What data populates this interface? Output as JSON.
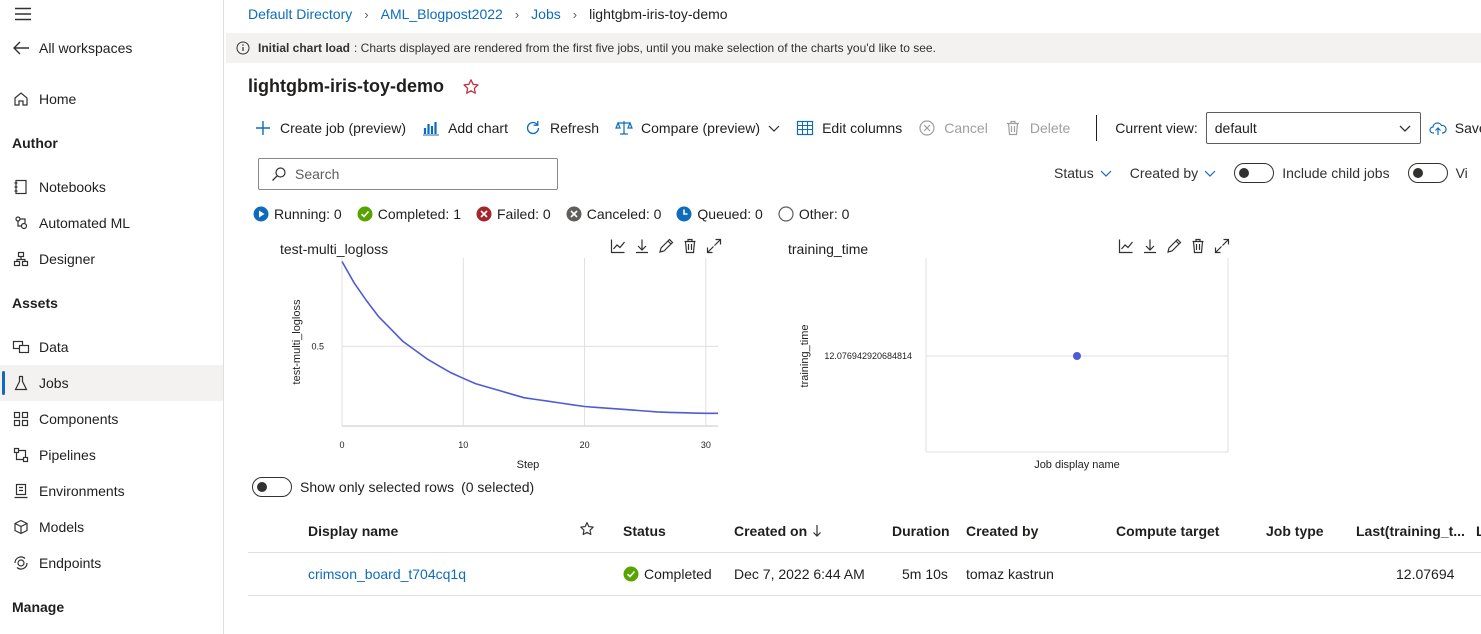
{
  "sidebar": {
    "back_label": "All workspaces",
    "home_label": "Home",
    "author_heading": "Author",
    "author_items": [
      {
        "label": "Notebooks",
        "icon": "notebook-icon"
      },
      {
        "label": "Automated ML",
        "icon": "automl-icon"
      },
      {
        "label": "Designer",
        "icon": "designer-icon"
      }
    ],
    "assets_heading": "Assets",
    "assets_items": [
      {
        "label": "Data",
        "icon": "data-icon"
      },
      {
        "label": "Jobs",
        "icon": "flask-icon",
        "active": true
      },
      {
        "label": "Components",
        "icon": "components-icon"
      },
      {
        "label": "Pipelines",
        "icon": "pipelines-icon"
      },
      {
        "label": "Environments",
        "icon": "environments-icon"
      },
      {
        "label": "Models",
        "icon": "cube-icon"
      },
      {
        "label": "Endpoints",
        "icon": "endpoints-icon"
      }
    ],
    "manage_heading": "Manage"
  },
  "breadcrumb": [
    "Default Directory",
    "AML_Blogpost2022",
    "Jobs",
    "lightgbm-iris-toy-demo"
  ],
  "infobar": {
    "bold": "Initial chart load",
    "text": ": Charts displayed are rendered from the first five jobs, until you make selection of the charts you'd like to see."
  },
  "page_title": "lightgbm-iris-toy-demo",
  "toolbar": {
    "create_job": "Create job (preview)",
    "add_chart": "Add chart",
    "refresh": "Refresh",
    "compare": "Compare (preview)",
    "edit_columns": "Edit columns",
    "cancel": "Cancel",
    "delete": "Delete",
    "current_view_label": "Current view:",
    "current_view_value": "default",
    "save_view": "Save view"
  },
  "search": {
    "placeholder": "Search"
  },
  "filters": {
    "status": "Status",
    "created_by": "Created by",
    "include_child_jobs": "Include child jobs",
    "view_toggle_label": "Vi"
  },
  "status_counts": [
    {
      "label": "Running: 0",
      "color": "#0f6cbd"
    },
    {
      "label": "Completed: 1",
      "color": "#57a300"
    },
    {
      "label": "Failed: 0",
      "color": "#a4262c"
    },
    {
      "label": "Canceled: 0",
      "color": "#605e5c"
    },
    {
      "label": "Queued: 0",
      "color": "#0f6cbd"
    },
    {
      "label": "Other: 0",
      "color": "#605e5c"
    }
  ],
  "chart_data": [
    {
      "type": "line",
      "title": "test-multi_logloss",
      "xlabel": "Step",
      "ylabel": "test-multi_logloss",
      "xlim": [
        0,
        31
      ],
      "x_ticks": [
        "0",
        "10",
        "20",
        "30"
      ],
      "y_ticks": [
        "0.5"
      ],
      "series": [
        {
          "x": [
            0,
            1,
            2,
            3,
            4,
            5,
            6,
            7,
            8,
            9,
            10,
            11,
            12,
            13,
            14,
            15,
            16,
            17,
            18,
            19,
            20,
            21,
            22,
            23,
            24,
            25,
            26,
            27,
            28,
            29,
            30,
            31
          ],
          "values": [
            0.98,
            0.86,
            0.76,
            0.67,
            0.6,
            0.53,
            0.48,
            0.43,
            0.39,
            0.35,
            0.32,
            0.29,
            0.27,
            0.25,
            0.23,
            0.21,
            0.2,
            0.19,
            0.18,
            0.17,
            0.16,
            0.155,
            0.15,
            0.145,
            0.14,
            0.135,
            0.13,
            0.127,
            0.125,
            0.123,
            0.122,
            0.122
          ],
          "color": "#4f5bd5"
        }
      ],
      "ylim": [
        0.05,
        1.0
      ]
    },
    {
      "type": "scatter",
      "title": "training_time",
      "xlabel": "Job display name",
      "ylabel": "training_time",
      "y_ticks": [
        "12.076942920684814"
      ],
      "series": [
        {
          "values": [
            12.076942920684814
          ],
          "color": "#4f5bd5"
        }
      ]
    }
  ],
  "show_selected": {
    "label": "Show only selected rows",
    "count": "(0 selected)"
  },
  "table": {
    "columns": [
      "Display name",
      "Status",
      "Created on",
      "Duration",
      "Created by",
      "Compute target",
      "Job type",
      "Last(training_t...",
      "L"
    ],
    "rows": [
      {
        "display_name": "crimson_board_t704cq1q",
        "status": "Completed",
        "created_on": "Dec 7, 2022 6:44 AM",
        "duration": "5m 10s",
        "created_by": "tomaz kastrun",
        "compute_target": "",
        "job_type": "",
        "last_training_time": "12.07694"
      }
    ]
  }
}
